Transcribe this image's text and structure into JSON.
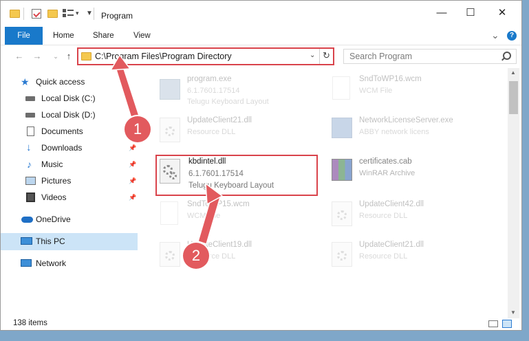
{
  "window": {
    "title": "Program",
    "controls": {
      "minimize": "—",
      "maximize": "☐",
      "close": "✕"
    }
  },
  "ribbon": {
    "tabs": [
      "File",
      "Home",
      "Share",
      "View"
    ],
    "expand": "⌄",
    "help": "?"
  },
  "address": {
    "path": "C:\\Program Files\\Program Directory",
    "search_placeholder": "Search Program"
  },
  "sidebar": {
    "items": [
      {
        "label": "Quick access",
        "icon": "star-icon",
        "pinned": false
      },
      {
        "label": "Local Disk (C:)",
        "icon": "drive-icon",
        "pinned": false
      },
      {
        "label": "Local Disk (D:)",
        "icon": "drive-icon",
        "pinned": false
      },
      {
        "label": "Documents",
        "icon": "documents-icon",
        "pinned": true
      },
      {
        "label": "Downloads",
        "icon": "downloads-icon",
        "pinned": true
      },
      {
        "label": "Music",
        "icon": "music-icon",
        "pinned": true
      },
      {
        "label": "Pictures",
        "icon": "pictures-icon",
        "pinned": true
      },
      {
        "label": "Videos",
        "icon": "videos-icon",
        "pinned": true
      },
      {
        "label": "OneDrive",
        "icon": "cloud-icon",
        "pinned": false
      },
      {
        "label": "This PC",
        "icon": "pc-icon",
        "pinned": false,
        "selected": true
      },
      {
        "label": "Network",
        "icon": "network-icon",
        "pinned": false
      }
    ]
  },
  "files": {
    "left": [
      {
        "name": "program.exe",
        "line1": "6.1.7601.17514",
        "line2": "Telugu Keyboard Layout",
        "type": "exe",
        "faded": true
      },
      {
        "name": "UpdateClient21.dll",
        "line1": "Resource DLL",
        "line2": "",
        "type": "dll",
        "faded": true
      },
      {
        "name": "kbdintel.dll",
        "line1": "6.1.7601.17514",
        "line2": "Telugu Keyboard Layout",
        "type": "dll",
        "faded": false,
        "highlighted": true
      },
      {
        "name": "SndToWP15.wcm",
        "line1": "WCM File",
        "line2": "",
        "type": "doc",
        "faded": true
      },
      {
        "name": "UpdateClient19.dll",
        "line1": "Resource DLL",
        "line2": "",
        "type": "dll",
        "faded": true
      }
    ],
    "right": [
      {
        "name": "SndToWP16.wcm",
        "line1": "WCM File",
        "line2": "",
        "type": "doc",
        "faded": true
      },
      {
        "name": "NetworkLicenseServer.exe",
        "line1": "ABBY network licens",
        "line2": "",
        "type": "exe2",
        "faded": true
      },
      {
        "name": "certificates.cab",
        "line1": "WinRAR Archive",
        "line2": "",
        "type": "rar",
        "faded": true
      },
      {
        "name": "UpdateClient42.dll",
        "line1": "Resource DLL",
        "line2": "",
        "type": "dll",
        "faded": true
      },
      {
        "name": "UpdateClient21.dll",
        "line1": "Resource DLL",
        "line2": "",
        "type": "dll",
        "faded": true
      }
    ]
  },
  "status": {
    "items": "138 items"
  },
  "annotations": {
    "step1": "1",
    "step2": "2",
    "color": "#e25a5e"
  }
}
